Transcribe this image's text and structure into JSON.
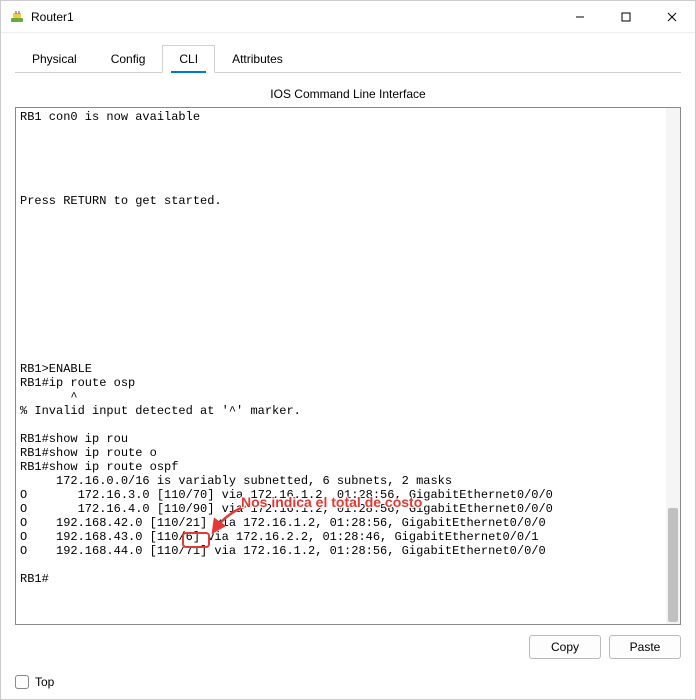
{
  "window": {
    "title": "Router1"
  },
  "tabs": {
    "physical": "Physical",
    "config": "Config",
    "cli": "CLI",
    "attributes": "Attributes"
  },
  "cli_header": "IOS Command Line Interface",
  "terminal_lines": [
    "RB1 con0 is now available",
    "",
    "",
    "",
    "",
    "",
    "Press RETURN to get started.",
    "",
    "",
    "",
    "",
    "",
    "",
    "",
    "",
    "",
    "",
    "",
    "RB1>ENABLE",
    "RB1#ip route osp",
    "       ^",
    "% Invalid input detected at '^' marker.",
    "",
    "RB1#show ip rou",
    "RB1#show ip route o",
    "RB1#show ip route ospf",
    "     172.16.0.0/16 is variably subnetted, 6 subnets, 2 masks",
    "O       172.16.3.0 [110/70] via 172.16.1.2, 01:28:56, GigabitEthernet0/0/0",
    "O       172.16.4.0 [110/90] via 172.16.1.2, 01:28:56, GigabitEthernet0/0/0",
    "O    192.168.42.0 [110/21] via 172.16.1.2, 01:28:56, GigabitEthernet0/0/0",
    "O    192.168.43.0 [110/6] via 172.16.2.2, 01:28:46, GigabitEthernet0/0/1",
    "O    192.168.44.0 [110/71] via 172.16.1.2, 01:28:56, GigabitEthernet0/0/0",
    "",
    "RB1#"
  ],
  "annotation": {
    "text": "Nos indica el total de costo"
  },
  "buttons": {
    "copy": "Copy",
    "paste": "Paste"
  },
  "bottom": {
    "top_label": "Top"
  }
}
